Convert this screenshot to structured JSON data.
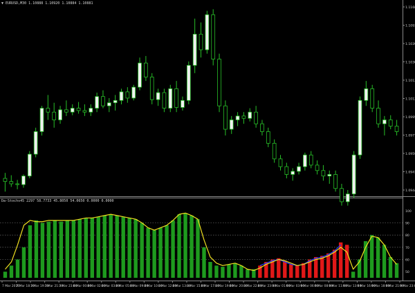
{
  "main_header": {
    "arrow": "▼",
    "symbol": "EURUSD,M30",
    "quotes": "1.10888 1.10920 1.10884 1.10881"
  },
  "indicator_header": {
    "text": "Da-Stochs45 2297 58.7733 45.8050 54.0650 0.0000 0.0000"
  },
  "price_axis": [
    "1.11680",
    "1.10935",
    "1.10390",
    "1.10300",
    "1.10125",
    "1.10125",
    "1.09950",
    "1.09770",
    "1.09595",
    "1.09415",
    "1.09445"
  ],
  "indicator_axis": [
    "100",
    "90",
    "80",
    "70",
    "60",
    "50"
  ],
  "time_axis": [
    "7 Mar 2016",
    "7 Mar 18:30",
    "7 Mar 19:30",
    "7 Mar 21:30",
    "7 Mar 23:00",
    "8 Mar 00:00",
    "8 Mar 02:00",
    "8 Mar 03:00",
    "8 Mar 05:00",
    "8 Mar 09:00",
    "8 Mar 10:30",
    "8 Mar 12:00",
    "8 Mar 13:30",
    "8 Mar 15:00",
    "8 Mar 17:30",
    "8 Mar 19:00",
    "8 Mar 20:30",
    "8 Mar 22:00",
    "8 Mar 23:30",
    "9 Mar 01:00",
    "9 Mar 03:00",
    "9 Mar 06:00",
    "9 Mar 08:00",
    "9 Mar 11:00",
    "9 Mar 13:00",
    "9 Mar 16:00",
    "9 Mar 18:00",
    "9 Mar 21:00",
    "9 Mar 23:00"
  ],
  "colors": {
    "background": "#000000",
    "frame": "#8a8a8a",
    "bull_body": "#f0f0f0",
    "bear_body": "#000000",
    "wick": "#28c028",
    "histogram_green": "#1e9a1e",
    "histogram_red": "#e01818",
    "signal_line": "#f0e020",
    "blue_line": "#2040ff",
    "grid_dots": "#5a5a5a",
    "axis_text": "#d0d0d0"
  },
  "chart_data": [
    {
      "type": "candlestick",
      "title": "EURUSD,M30",
      "ylim": [
        1.094,
        1.1175
      ],
      "candles": [
        [
          1.0955,
          1.0962,
          1.0938,
          1.0951
        ],
        [
          1.0951,
          1.0959,
          1.0944,
          1.0948
        ],
        [
          1.0948,
          1.0953,
          1.0941,
          1.0947
        ],
        [
          1.0947,
          1.096,
          1.0943,
          1.0958
        ],
        [
          1.0958,
          1.099,
          1.0955,
          1.0986
        ],
        [
          1.0986,
          1.102,
          1.0982,
          1.1015
        ],
        [
          1.1015,
          1.1048,
          1.101,
          1.1045
        ],
        [
          1.1045,
          1.1062,
          1.103,
          1.104
        ],
        [
          1.104,
          1.1052,
          1.102,
          1.103
        ],
        [
          1.103,
          1.1048,
          1.1025,
          1.1043
        ],
        [
          1.1043,
          1.1055,
          1.1035,
          1.104
        ],
        [
          1.104,
          1.105,
          1.1036,
          1.1045
        ],
        [
          1.1045,
          1.1053,
          1.1038,
          1.1042
        ],
        [
          1.1042,
          1.105,
          1.1035,
          1.104
        ],
        [
          1.104,
          1.105,
          1.1035,
          1.1045
        ],
        [
          1.1045,
          1.1065,
          1.104,
          1.106
        ],
        [
          1.106,
          1.1068,
          1.1045,
          1.1048
        ],
        [
          1.1048,
          1.1058,
          1.104,
          1.1052
        ],
        [
          1.1052,
          1.1062,
          1.1042,
          1.1055
        ],
        [
          1.1055,
          1.107,
          1.105,
          1.1066
        ],
        [
          1.1066,
          1.1072,
          1.1052,
          1.1058
        ],
        [
          1.1058,
          1.1075,
          1.1055,
          1.1072
        ],
        [
          1.1072,
          1.111,
          1.1068,
          1.1103
        ],
        [
          1.1103,
          1.1112,
          1.108,
          1.1085
        ],
        [
          1.1085,
          1.109,
          1.105,
          1.1056
        ],
        [
          1.1056,
          1.107,
          1.1048,
          1.1065
        ],
        [
          1.1065,
          1.107,
          1.104,
          1.1045
        ],
        [
          1.1045,
          1.1075,
          1.104,
          1.107
        ],
        [
          1.107,
          1.108,
          1.104,
          1.1046
        ],
        [
          1.1046,
          1.106,
          1.1042,
          1.1055
        ],
        [
          1.1055,
          1.1105,
          1.105,
          1.11
        ],
        [
          1.11,
          1.116,
          1.109,
          1.114
        ],
        [
          1.114,
          1.1155,
          1.111,
          1.112
        ],
        [
          1.112,
          1.117,
          1.1115,
          1.1165
        ],
        [
          1.1165,
          1.1172,
          1.11,
          1.1108
        ],
        [
          1.1108,
          1.1115,
          1.104,
          1.1048
        ],
        [
          1.1048,
          1.1055,
          1.101,
          1.1018
        ],
        [
          1.1018,
          1.1035,
          1.1012,
          1.103
        ],
        [
          1.103,
          1.104,
          1.1022,
          1.1035
        ],
        [
          1.1035,
          1.104,
          1.1025,
          1.1032
        ],
        [
          1.1032,
          1.1045,
          1.1028,
          1.104
        ],
        [
          1.104,
          1.1048,
          1.102,
          1.1025
        ],
        [
          1.1025,
          1.103,
          1.101,
          1.1015
        ],
        [
          1.1015,
          1.102,
          1.0995,
          1.1
        ],
        [
          1.1,
          1.1005,
          1.0975,
          1.098
        ],
        [
          1.098,
          1.0985,
          1.0965,
          1.097
        ],
        [
          1.097,
          1.0975,
          1.0955,
          1.096
        ],
        [
          1.096,
          1.0968,
          1.0952,
          1.0964
        ],
        [
          1.0964,
          1.0975,
          1.096,
          1.097
        ],
        [
          1.097,
          1.0988,
          1.0965,
          1.0985
        ],
        [
          1.0985,
          1.099,
          1.0968,
          1.0972
        ],
        [
          1.0972,
          1.0978,
          1.096,
          1.0965
        ],
        [
          1.0965,
          1.0972,
          1.0952,
          1.0958
        ],
        [
          1.0958,
          1.0965,
          1.0948,
          1.096
        ],
        [
          1.096,
          1.0965,
          1.0938,
          1.0942
        ],
        [
          1.0942,
          1.0948,
          1.092,
          1.0925
        ],
        [
          1.0925,
          1.094,
          1.092,
          1.0935
        ],
        [
          1.0935,
          1.099,
          1.093,
          1.0985
        ],
        [
          1.0985,
          1.106,
          1.098,
          1.1055
        ],
        [
          1.1055,
          1.108,
          1.1048,
          1.107
        ],
        [
          1.107,
          1.1075,
          1.104,
          1.1045
        ],
        [
          1.1045,
          1.1055,
          1.102,
          1.1025
        ],
        [
          1.1025,
          1.1035,
          1.101,
          1.103
        ],
        [
          1.103,
          1.1036,
          1.1018,
          1.1022
        ],
        [
          1.1022,
          1.103,
          1.101,
          1.1015
        ]
      ]
    },
    {
      "type": "bar",
      "title": "Da-Stochs",
      "ylim": [
        45,
        105
      ],
      "histogram": [
        {
          "v": 50,
          "c": "green"
        },
        {
          "v": 55,
          "c": "green"
        },
        {
          "v": 60,
          "c": "green"
        },
        {
          "v": 70,
          "c": "green"
        },
        {
          "v": 88,
          "c": "green"
        },
        {
          "v": 92,
          "c": "green"
        },
        {
          "v": 90,
          "c": "green"
        },
        {
          "v": 91,
          "c": "green"
        },
        {
          "v": 92,
          "c": "green"
        },
        {
          "v": 91,
          "c": "green"
        },
        {
          "v": 92,
          "c": "green"
        },
        {
          "v": 92,
          "c": "green"
        },
        {
          "v": 93,
          "c": "green"
        },
        {
          "v": 94,
          "c": "green"
        },
        {
          "v": 94,
          "c": "green"
        },
        {
          "v": 95,
          "c": "green"
        },
        {
          "v": 96,
          "c": "green"
        },
        {
          "v": 97,
          "c": "green"
        },
        {
          "v": 96,
          "c": "green"
        },
        {
          "v": 95,
          "c": "green"
        },
        {
          "v": 94,
          "c": "green"
        },
        {
          "v": 93,
          "c": "green"
        },
        {
          "v": 90,
          "c": "green"
        },
        {
          "v": 86,
          "c": "green"
        },
        {
          "v": 84,
          "c": "green"
        },
        {
          "v": 86,
          "c": "green"
        },
        {
          "v": 88,
          "c": "green"
        },
        {
          "v": 92,
          "c": "green"
        },
        {
          "v": 97,
          "c": "green"
        },
        {
          "v": 98,
          "c": "green"
        },
        {
          "v": 96,
          "c": "green"
        },
        {
          "v": 93,
          "c": "green"
        },
        {
          "v": 70,
          "c": "green"
        },
        {
          "v": 58,
          "c": "green"
        },
        {
          "v": 55,
          "c": "green"
        },
        {
          "v": 54,
          "c": "green"
        },
        {
          "v": 56,
          "c": "green"
        },
        {
          "v": 57,
          "c": "green"
        },
        {
          "v": 55,
          "c": "green"
        },
        {
          "v": 52,
          "c": "green"
        },
        {
          "v": 52,
          "c": "green"
        },
        {
          "v": 55,
          "c": "red"
        },
        {
          "v": 58,
          "c": "red"
        },
        {
          "v": 60,
          "c": "red"
        },
        {
          "v": 61,
          "c": "red"
        },
        {
          "v": 59,
          "c": "red"
        },
        {
          "v": 56,
          "c": "red"
        },
        {
          "v": 55,
          "c": "red"
        },
        {
          "v": 57,
          "c": "red"
        },
        {
          "v": 60,
          "c": "red"
        },
        {
          "v": 62,
          "c": "red"
        },
        {
          "v": 63,
          "c": "red"
        },
        {
          "v": 65,
          "c": "red"
        },
        {
          "v": 68,
          "c": "red"
        },
        {
          "v": 74,
          "c": "red"
        },
        {
          "v": 72,
          "c": "red"
        },
        {
          "v": 50,
          "c": "green"
        },
        {
          "v": 60,
          "c": "green"
        },
        {
          "v": 75,
          "c": "green"
        },
        {
          "v": 80,
          "c": "green"
        },
        {
          "v": 78,
          "c": "green"
        },
        {
          "v": 72,
          "c": "green"
        },
        {
          "v": 62,
          "c": "green"
        },
        {
          "v": 57,
          "c": "green"
        }
      ],
      "signal_line": [
        52,
        58,
        72,
        88,
        92,
        91,
        91,
        92,
        92,
        92,
        92,
        92,
        93,
        94,
        94,
        95,
        96,
        97,
        96,
        95,
        94,
        93,
        90,
        86,
        84,
        86,
        88,
        92,
        97,
        98,
        96,
        93,
        76,
        62,
        57,
        55,
        56,
        57,
        55,
        52,
        51,
        53,
        56,
        58,
        60,
        59,
        57,
        55,
        56,
        58,
        60,
        61,
        63,
        66,
        70,
        66,
        52,
        58,
        70,
        79,
        78,
        72,
        62,
        56
      ],
      "blue_line": [
        null,
        null,
        null,
        null,
        null,
        null,
        null,
        null,
        null,
        null,
        null,
        null,
        null,
        null,
        null,
        null,
        null,
        null,
        null,
        null,
        null,
        null,
        null,
        null,
        null,
        null,
        null,
        null,
        null,
        null,
        null,
        null,
        null,
        null,
        null,
        null,
        null,
        null,
        null,
        null,
        null,
        55,
        57,
        59,
        60,
        58,
        56,
        55,
        56,
        59,
        61,
        62,
        64,
        67,
        72,
        null,
        null,
        null,
        null,
        null,
        null,
        null,
        null,
        null
      ]
    }
  ]
}
